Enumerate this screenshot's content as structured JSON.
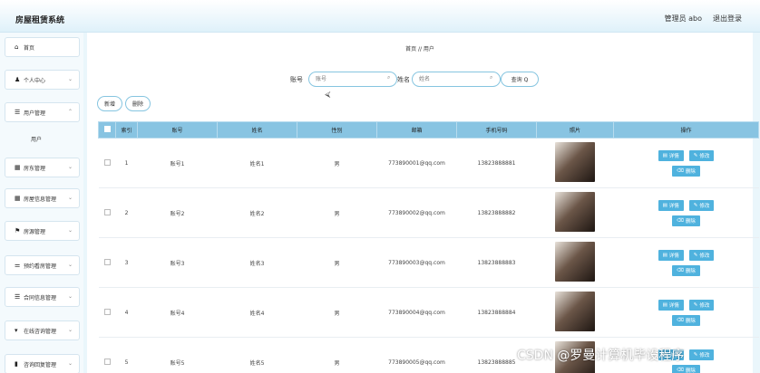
{
  "header": {
    "app_title": "房屋租赁系统",
    "admin_label": "管理员 abo",
    "logout_label": "退出登录"
  },
  "sidebar": {
    "items": [
      {
        "label": "首页",
        "icon": "home-icon",
        "has_chevron": false
      },
      {
        "label": "个人中心",
        "icon": "user-icon",
        "has_chevron": true
      },
      {
        "label": "用户管理",
        "icon": "list-icon",
        "has_chevron": true
      },
      {
        "label": "房东管理",
        "icon": "grid-icon",
        "has_chevron": true
      },
      {
        "label": "房屋信息管理",
        "icon": "grid-icon",
        "has_chevron": true
      },
      {
        "label": "房源管理",
        "icon": "flag-icon",
        "has_chevron": true
      },
      {
        "label": "预约看房管理",
        "icon": "sliders-icon",
        "has_chevron": true
      },
      {
        "label": "合同信息管理",
        "icon": "list-icon",
        "has_chevron": true
      },
      {
        "label": "在线咨询管理",
        "icon": "pin-icon",
        "has_chevron": true
      },
      {
        "label": "咨询回复管理",
        "icon": "book-icon",
        "has_chevron": true
      }
    ],
    "sub_item": "用户"
  },
  "breadcrumb": "首页 // 用户",
  "search": {
    "account_label": "账号",
    "account_placeholder": "账号",
    "name_label": "姓名",
    "name_placeholder": "姓名",
    "query_label": "查询 Q"
  },
  "toolbar": {
    "add_label": "新增",
    "delete_label": "删除"
  },
  "table": {
    "headers": [
      "",
      "索引",
      "账号",
      "姓名",
      "性别",
      "邮箱",
      "手机号码",
      "照片",
      "操作"
    ],
    "rows": [
      {
        "index": "1",
        "account": "账号1",
        "name": "姓名1",
        "gender": "男",
        "email": "773890001@qq.com",
        "phone": "13823888881"
      },
      {
        "index": "2",
        "account": "账号2",
        "name": "姓名2",
        "gender": "男",
        "email": "773890002@qq.com",
        "phone": "13823888882"
      },
      {
        "index": "3",
        "account": "账号3",
        "name": "姓名3",
        "gender": "男",
        "email": "773890003@qq.com",
        "phone": "13823888883"
      },
      {
        "index": "4",
        "account": "账号4",
        "name": "姓名4",
        "gender": "男",
        "email": "773890004@qq.com",
        "phone": "13823888884"
      },
      {
        "index": "5",
        "account": "账号5",
        "name": "姓名5",
        "gender": "男",
        "email": "773890005@qq.com",
        "phone": "13823888885"
      }
    ],
    "actions": {
      "detail": "详情",
      "edit": "修改",
      "delete": "删除"
    }
  },
  "watermark": "CSDN @罗曼计算机毕设程序",
  "colors": {
    "accent": "#4fb2de",
    "table_header": "#88c4e2",
    "border": "#86c5e0"
  }
}
